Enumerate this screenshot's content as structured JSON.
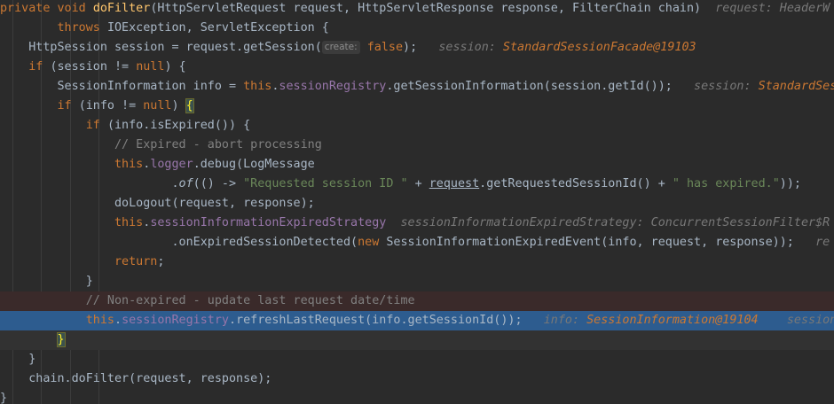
{
  "lines": [
    [
      [
        "kw",
        "private void "
      ],
      [
        "fn",
        "doFilter"
      ],
      [
        "p",
        "(HttpServletRequest request, HttpServletResponse response, FilterChain chain)  "
      ],
      [
        "hint",
        "request: HeaderW"
      ]
    ],
    [
      [
        "p",
        "        "
      ],
      [
        "kw",
        "throws "
      ],
      [
        "p",
        "IOException, ServletException {"
      ]
    ],
    [
      [
        "p",
        "    HttpSession session = request.getSession("
      ],
      [
        "param",
        "create:"
      ],
      [
        "kw",
        " false"
      ],
      [
        "p",
        ");   "
      ],
      [
        "hint",
        "session: "
      ],
      [
        "hintv",
        "StandardSessionFacade@19103"
      ]
    ],
    [
      [
        "p",
        "    "
      ],
      [
        "kw",
        "if "
      ],
      [
        "p",
        "(session != "
      ],
      [
        "kw",
        "null"
      ],
      [
        "p",
        ") {"
      ]
    ],
    [
      [
        "p",
        "        SessionInformation info = "
      ],
      [
        "kw",
        "this"
      ],
      [
        "p",
        "."
      ],
      [
        "fld",
        "sessionRegistry"
      ],
      [
        "p",
        ".getSessionInformation(session.getId());   "
      ],
      [
        "hint",
        "session: "
      ],
      [
        "hintv",
        "StandardSes"
      ]
    ],
    [
      [
        "p",
        "        "
      ],
      [
        "kw",
        "if "
      ],
      [
        "p",
        "(info != "
      ],
      [
        "kw",
        "null"
      ],
      [
        "p",
        ") "
      ],
      [
        "brace",
        "{"
      ]
    ],
    [
      [
        "p",
        "            "
      ],
      [
        "kw",
        "if "
      ],
      [
        "p",
        "(info.isExpired()) {"
      ]
    ],
    [
      [
        "p",
        "                "
      ],
      [
        "cmt",
        "// Expired - abort processing"
      ]
    ],
    [
      [
        "p",
        "                "
      ],
      [
        "kw",
        "this"
      ],
      [
        "p",
        "."
      ],
      [
        "fld",
        "logger"
      ],
      [
        "p",
        ".debug(LogMessage"
      ]
    ],
    [
      [
        "p",
        "                        ."
      ],
      [
        "it",
        "of"
      ],
      [
        "p",
        "(() -> "
      ],
      [
        "str",
        "\"Requested session ID \""
      ],
      [
        "p",
        " + "
      ],
      [
        "under",
        "request"
      ],
      [
        "p",
        ".getRequestedSessionId() + "
      ],
      [
        "str",
        "\" has expired.\""
      ],
      [
        "p",
        "));"
      ]
    ],
    [
      [
        "p",
        "                doLogout(request, response);"
      ]
    ],
    [
      [
        "p",
        "                "
      ],
      [
        "kw",
        "this"
      ],
      [
        "p",
        "."
      ],
      [
        "fld",
        "sessionInformationExpiredStrategy"
      ],
      [
        "p",
        "  "
      ],
      [
        "hint",
        "sessionInformationExpiredStrategy: ConcurrentSessionFilter$R"
      ]
    ],
    [
      [
        "p",
        "                        .onExpiredSessionDetected("
      ],
      [
        "kw",
        "new "
      ],
      [
        "p",
        "SessionInformationExpiredEvent(info, request, response));   "
      ],
      [
        "hint",
        "re"
      ]
    ],
    [
      [
        "p",
        "                "
      ],
      [
        "kw",
        "return"
      ],
      [
        "p",
        ";"
      ]
    ],
    [
      [
        "p",
        "            }"
      ]
    ],
    [
      [
        "p",
        "            "
      ],
      [
        "cmt",
        "// Non-expired - update last request date/time"
      ]
    ],
    [
      [
        "p",
        "            "
      ],
      [
        "kw",
        "this"
      ],
      [
        "p",
        "."
      ],
      [
        "fld",
        "sessionRegistry"
      ],
      [
        "p",
        ".refreshLastRequest(info.getSessionId());   "
      ],
      [
        "hint",
        "info: "
      ],
      [
        "hintv",
        "SessionInformation@19104"
      ],
      [
        "p",
        "    "
      ],
      [
        "hint",
        "session"
      ]
    ],
    [
      [
        "p",
        "        "
      ],
      [
        "brace",
        "}"
      ],
      [
        "caret",
        ""
      ]
    ],
    [
      [
        "p",
        "    }"
      ]
    ],
    [
      [
        "p",
        "    chain.doFilter(request, response);"
      ]
    ],
    [
      [
        "p",
        "}"
      ]
    ]
  ],
  "line_classes": [
    "",
    "",
    "",
    "",
    "",
    "",
    "",
    "",
    "",
    "",
    "",
    "",
    "",
    "",
    "",
    "ex",
    "sel",
    "cur",
    "",
    "",
    ""
  ]
}
